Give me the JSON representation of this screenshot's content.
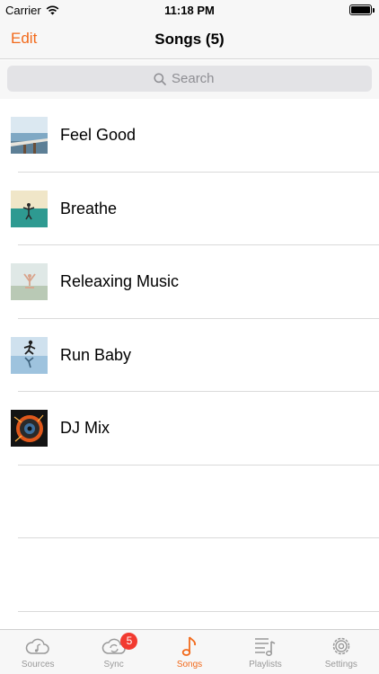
{
  "status_bar": {
    "carrier": "Carrier",
    "time": "11:18 PM"
  },
  "nav": {
    "edit_label": "Edit",
    "title": "Songs (5)"
  },
  "search": {
    "placeholder": "Search"
  },
  "songs": [
    {
      "title": "Feel Good",
      "thumb": "pier-sky-icon"
    },
    {
      "title": "Breathe",
      "thumb": "meditation-sea-icon"
    },
    {
      "title": "Releaxing Music",
      "thumb": "yoga-mist-icon"
    },
    {
      "title": "Run Baby",
      "thumb": "runner-reflection-icon"
    },
    {
      "title": "DJ Mix",
      "thumb": "fiery-speaker-icon"
    }
  ],
  "tabs": [
    {
      "label": "Sources",
      "icon": "cloud-music-icon"
    },
    {
      "label": "Sync",
      "icon": "cloud-sync-icon",
      "badge": "5"
    },
    {
      "label": "Songs",
      "icon": "music-note-icon",
      "active": true
    },
    {
      "label": "Playlists",
      "icon": "playlist-icon"
    },
    {
      "label": "Settings",
      "icon": "gear-icon"
    }
  ],
  "colors": {
    "accent": "#f26a1b",
    "inactive": "#999999",
    "badge": "#f23a30"
  }
}
